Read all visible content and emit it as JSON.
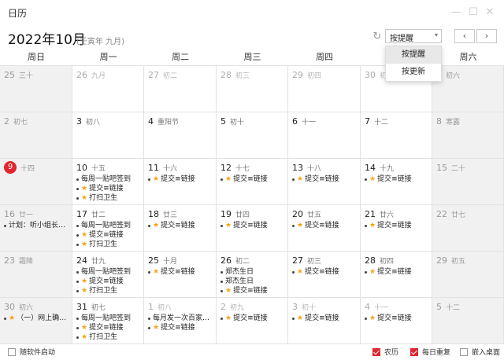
{
  "window": {
    "title": "日历",
    "minimize_icon": "minimize-icon",
    "maximize_icon": "maximize-icon",
    "close_icon": "close-icon"
  },
  "header": {
    "month_title": "2022年10月",
    "lunar_year": "(壬寅年 九月)",
    "refresh_icon": "refresh-icon",
    "sort_value": "按提醒",
    "prev_label": "‹",
    "next_label": "›"
  },
  "dropdown": {
    "options": [
      "按提醒",
      "按更新"
    ],
    "active_index": 0
  },
  "weekdays": [
    "周日",
    "周一",
    "周二",
    "周三",
    "周四",
    "周五",
    "周六"
  ],
  "colors": {
    "accent": "#e0262f",
    "star": "#f2a51a",
    "weekend_bg": "#f1f1f1"
  },
  "weeks": [
    [
      {
        "day": "25",
        "lunar": "三十",
        "other": true,
        "events": []
      },
      {
        "day": "26",
        "lunar": "九月",
        "other": true,
        "events": []
      },
      {
        "day": "27",
        "lunar": "初二",
        "other": true,
        "events": []
      },
      {
        "day": "28",
        "lunar": "初三",
        "other": true,
        "events": []
      },
      {
        "day": "29",
        "lunar": "初四",
        "other": true,
        "events": []
      },
      {
        "day": "30",
        "lunar": "初五",
        "other": true,
        "events": []
      },
      {
        "day": "1",
        "lunar": "初六",
        "other": false,
        "events": []
      }
    ],
    [
      {
        "day": "2",
        "lunar": "初七",
        "other": false,
        "events": []
      },
      {
        "day": "3",
        "lunar": "初八",
        "other": false,
        "events": []
      },
      {
        "day": "4",
        "lunar": "重阳节",
        "other": false,
        "events": []
      },
      {
        "day": "5",
        "lunar": "初十",
        "other": false,
        "events": []
      },
      {
        "day": "6",
        "lunar": "十一",
        "other": false,
        "events": []
      },
      {
        "day": "7",
        "lunar": "十二",
        "other": false,
        "events": []
      },
      {
        "day": "8",
        "lunar": "寒露",
        "other": false,
        "events": []
      }
    ],
    [
      {
        "day": "9",
        "lunar": "十四",
        "other": false,
        "today": true,
        "events": []
      },
      {
        "day": "10",
        "lunar": "十五",
        "other": false,
        "events": [
          {
            "text": "每周一贴吧签到",
            "star": false
          },
          {
            "text": "提交≡链接",
            "star": true
          },
          {
            "text": "打扫卫生",
            "star": true
          }
        ]
      },
      {
        "day": "11",
        "lunar": "十六",
        "other": false,
        "events": [
          {
            "text": "提交≡链接",
            "star": true
          }
        ]
      },
      {
        "day": "12",
        "lunar": "十七",
        "other": false,
        "events": [
          {
            "text": "提交≡链接",
            "star": true
          }
        ]
      },
      {
        "day": "13",
        "lunar": "十八",
        "other": false,
        "events": [
          {
            "text": "提交≡链接",
            "star": true
          }
        ]
      },
      {
        "day": "14",
        "lunar": "十九",
        "other": false,
        "events": [
          {
            "text": "提交≡链接",
            "star": true
          }
        ]
      },
      {
        "day": "15",
        "lunar": "二十",
        "other": false,
        "events": []
      }
    ],
    [
      {
        "day": "16",
        "lunar": "廿一",
        "other": false,
        "events": [
          {
            "text": "计划：听小组长汇报工作",
            "star": false
          }
        ]
      },
      {
        "day": "17",
        "lunar": "廿二",
        "other": false,
        "events": [
          {
            "text": "每周一贴吧签到",
            "star": false
          },
          {
            "text": "提交≡链接",
            "star": true
          },
          {
            "text": "打扫卫生",
            "star": true
          }
        ]
      },
      {
        "day": "18",
        "lunar": "廿三",
        "other": false,
        "events": [
          {
            "text": "提交≡链接",
            "star": true
          }
        ]
      },
      {
        "day": "19",
        "lunar": "廿四",
        "other": false,
        "events": [
          {
            "text": "提交≡链接",
            "star": true
          }
        ]
      },
      {
        "day": "20",
        "lunar": "廿五",
        "other": false,
        "events": [
          {
            "text": "提交≡链接",
            "star": true
          }
        ]
      },
      {
        "day": "21",
        "lunar": "廿六",
        "other": false,
        "events": [
          {
            "text": "提交≡链接",
            "star": true
          }
        ]
      },
      {
        "day": "22",
        "lunar": "廿七",
        "other": false,
        "events": []
      }
    ],
    [
      {
        "day": "23",
        "lunar": "霜降",
        "other": false,
        "events": []
      },
      {
        "day": "24",
        "lunar": "廿九",
        "other": false,
        "events": [
          {
            "text": "每周一贴吧签到",
            "star": false
          },
          {
            "text": "提交≡链接",
            "star": true
          },
          {
            "text": "打扫卫生",
            "star": true
          }
        ]
      },
      {
        "day": "25",
        "lunar": "十月",
        "other": false,
        "events": [
          {
            "text": "提交≡链接",
            "star": true
          }
        ]
      },
      {
        "day": "26",
        "lunar": "初二",
        "other": false,
        "events": [
          {
            "text": "郑杰生日",
            "star": false
          },
          {
            "text": "郑杰生日",
            "star": false
          },
          {
            "text": "提交≡链接",
            "star": true
          }
        ]
      },
      {
        "day": "27",
        "lunar": "初三",
        "other": false,
        "events": [
          {
            "text": "提交≡链接",
            "star": true
          }
        ]
      },
      {
        "day": "28",
        "lunar": "初四",
        "other": false,
        "events": [
          {
            "text": "提交≡链接",
            "star": true
          }
        ]
      },
      {
        "day": "29",
        "lunar": "初五",
        "other": false,
        "events": []
      }
    ],
    [
      {
        "day": "30",
        "lunar": "初六",
        "other": false,
        "events": [
          {
            "text": "（一）网上确认报名信息",
            "star": true
          }
        ]
      },
      {
        "day": "31",
        "lunar": "初七",
        "other": false,
        "events": [
          {
            "text": "每周一贴吧签到",
            "star": false
          },
          {
            "text": "提交≡链接",
            "star": true
          },
          {
            "text": "打扫卫生",
            "star": true
          }
        ]
      },
      {
        "day": "1",
        "lunar": "初八",
        "other": true,
        "events": [
          {
            "text": "每月发一次百家号老号",
            "star": false
          },
          {
            "text": "提交≡链接",
            "star": true
          }
        ]
      },
      {
        "day": "2",
        "lunar": "初九",
        "other": true,
        "events": [
          {
            "text": "提交≡链接",
            "star": true
          }
        ]
      },
      {
        "day": "3",
        "lunar": "初十",
        "other": true,
        "events": [
          {
            "text": "提交≡链接",
            "star": true
          }
        ]
      },
      {
        "day": "4",
        "lunar": "十一",
        "other": true,
        "events": [
          {
            "text": "提交≡链接",
            "star": true
          }
        ]
      },
      {
        "day": "5",
        "lunar": "十二",
        "other": true,
        "events": []
      }
    ]
  ],
  "footer": {
    "autostart": {
      "label": "随软件启动",
      "checked": false
    },
    "lunar": {
      "label": "农历",
      "checked": true
    },
    "daily_repeat": {
      "label": "每日重复",
      "checked": true
    },
    "embed_desktop": {
      "label": "嵌入桌面",
      "checked": false
    }
  }
}
